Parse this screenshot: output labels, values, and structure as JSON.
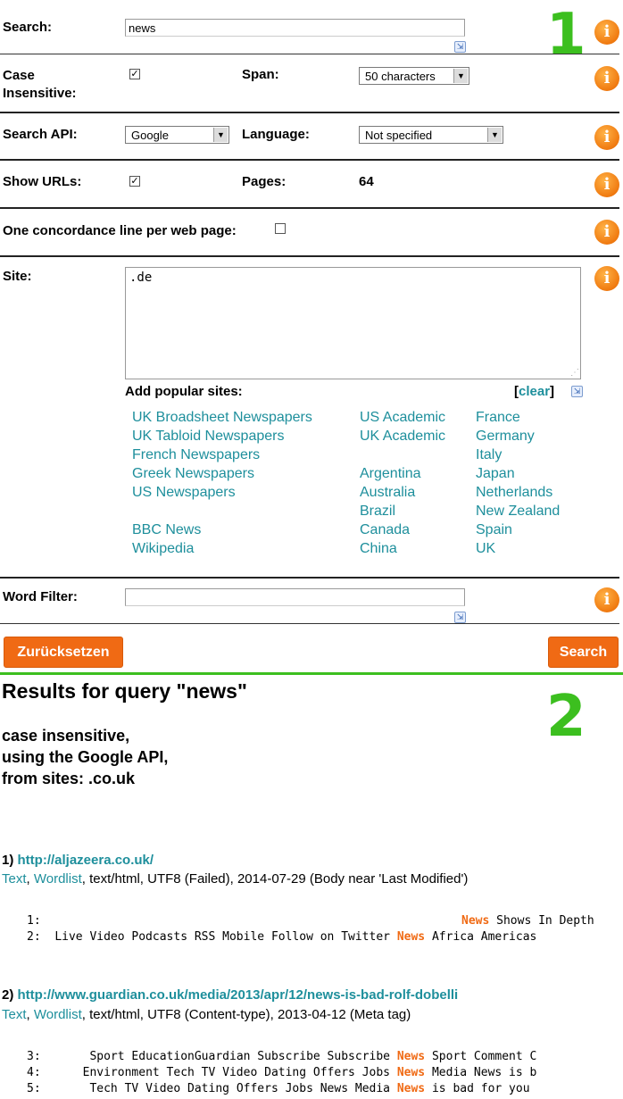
{
  "form": {
    "search_label": "Search:",
    "search_value": "news",
    "case_label": "Case Insensitive:",
    "case_checked": "✓",
    "span_label": "Span:",
    "span_value": "50 characters",
    "api_label": "Search API:",
    "api_value": "Google",
    "language_label": "Language:",
    "language_value": "Not specified",
    "urls_label": "Show URLs:",
    "urls_checked": "✓",
    "pages_label": "Pages:",
    "pages_value": "64",
    "one_line_label": "One concordance line per web page:",
    "site_label": "Site:",
    "site_value": ".de",
    "popular_label": "Add popular sites:",
    "clear_label": "clear",
    "word_filter_label": "Word Filter:",
    "reset_button": "Zurücksetzen",
    "search_button": "Search",
    "info_glyph": "i",
    "resize_glyph": "⇲"
  },
  "sites": {
    "col1": [
      "UK Broadsheet Newspapers",
      "UK Tabloid Newspapers",
      "French Newspapers",
      "Greek Newspapers",
      "US Newspapers",
      "BBC News",
      "Wikipedia"
    ],
    "col2": [
      "US Academic",
      "UK Academic",
      "Argentina",
      "Australia",
      "Brazil",
      "Canada",
      "China"
    ],
    "col3": [
      "France",
      "Germany",
      "Italy",
      "Japan",
      "Netherlands",
      "New Zealand",
      "Spain",
      "UK"
    ]
  },
  "annotations": {
    "one": "1",
    "two": "2"
  },
  "results": {
    "heading": "Results for query \"news\"",
    "summary_1": "case insensitive,",
    "summary_2": "using the Google API,",
    "summary_3": "from sites: .co.uk",
    "items": [
      {
        "num": "1)",
        "url": "http://aljazeera.co.uk/",
        "text_link": "Text",
        "wordlist_link": "Wordlist",
        "meta": ", text/html, UTF8 (Failed), 2014-07-29 (Body near 'Last Modified')",
        "lines": [
          {
            "n": "1:",
            "left": "",
            "hit": "News",
            "right": "Shows In Depth"
          },
          {
            "n": "2:",
            "left": "Live Video Podcasts RSS Mobile Follow on Twitter",
            "hit": "News",
            "right": "Africa Americas"
          }
        ]
      },
      {
        "num": "2)",
        "url": "http://www.guardian.co.uk/media/2013/apr/12/news-is-bad-rolf-dobelli",
        "text_link": "Text",
        "wordlist_link": "Wordlist",
        "meta": ", text/html, UTF8 (Content-type), 2013-04-12 (Meta tag)",
        "lines": [
          {
            "n": "3:",
            "left": "Sport EducationGuardian Subscribe Subscribe",
            "hit": "News",
            "right": "Sport Comment C"
          },
          {
            "n": "4:",
            "left": "Environment Tech TV Video Dating Offers Jobs",
            "hit": "News",
            "right": "Media News is b"
          },
          {
            "n": "5:",
            "left": "Tech TV Video Dating Offers Jobs News Media",
            "hit": "News",
            "right": "is bad for you"
          }
        ]
      }
    ]
  },
  "colors": {
    "accent": "#f06a14",
    "link": "#1e8f9c",
    "annotation": "#3cbf1f"
  }
}
